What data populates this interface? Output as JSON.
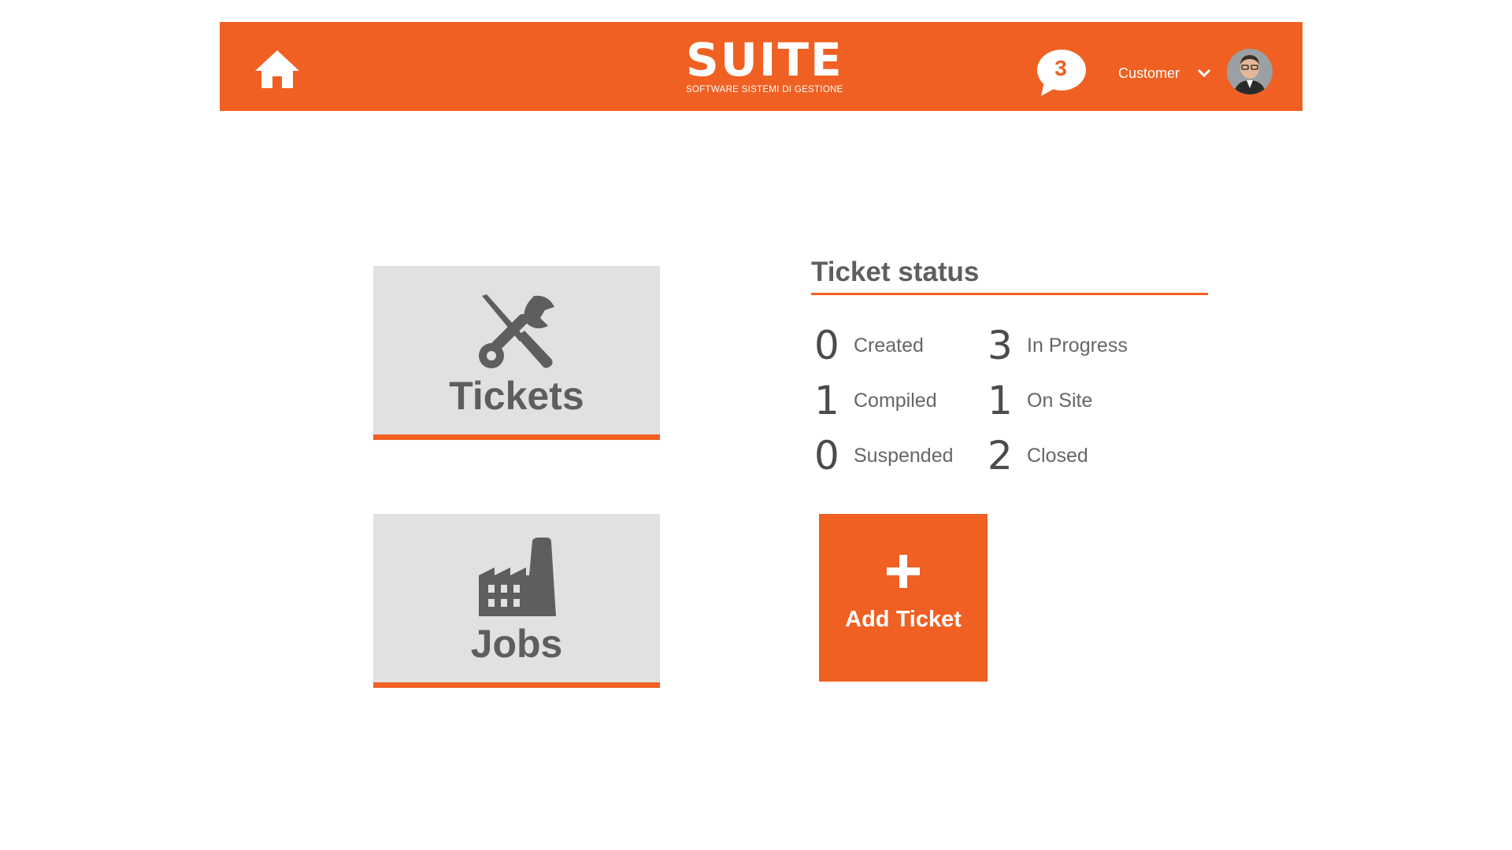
{
  "header": {
    "logo_title": "SUITE",
    "logo_subtitle": "SOFTWARE SISTEMI DI GESTIONE",
    "notifications_count": "3",
    "user_label": "Customer"
  },
  "tiles": {
    "tickets_label": "Tickets",
    "jobs_label": "Jobs"
  },
  "ticket_status": {
    "title": "Ticket status",
    "items": [
      {
        "count": "0",
        "label": "Created"
      },
      {
        "count": "1",
        "label": "Compiled"
      },
      {
        "count": "0",
        "label": "Suspended"
      },
      {
        "count": "3",
        "label": "In Progress"
      },
      {
        "count": "1",
        "label": "On Site"
      },
      {
        "count": "2",
        "label": "Closed"
      }
    ]
  },
  "add_ticket": {
    "label": "Add Ticket"
  },
  "colors": {
    "accent": "#f06022",
    "tile_bg": "#e1e1e1",
    "text_gray": "#5e5e5e"
  },
  "icons": [
    "home-icon",
    "chat-bubble-icon",
    "chevron-down-icon",
    "user-avatar",
    "tools-icon",
    "factory-icon",
    "plus-icon"
  ]
}
